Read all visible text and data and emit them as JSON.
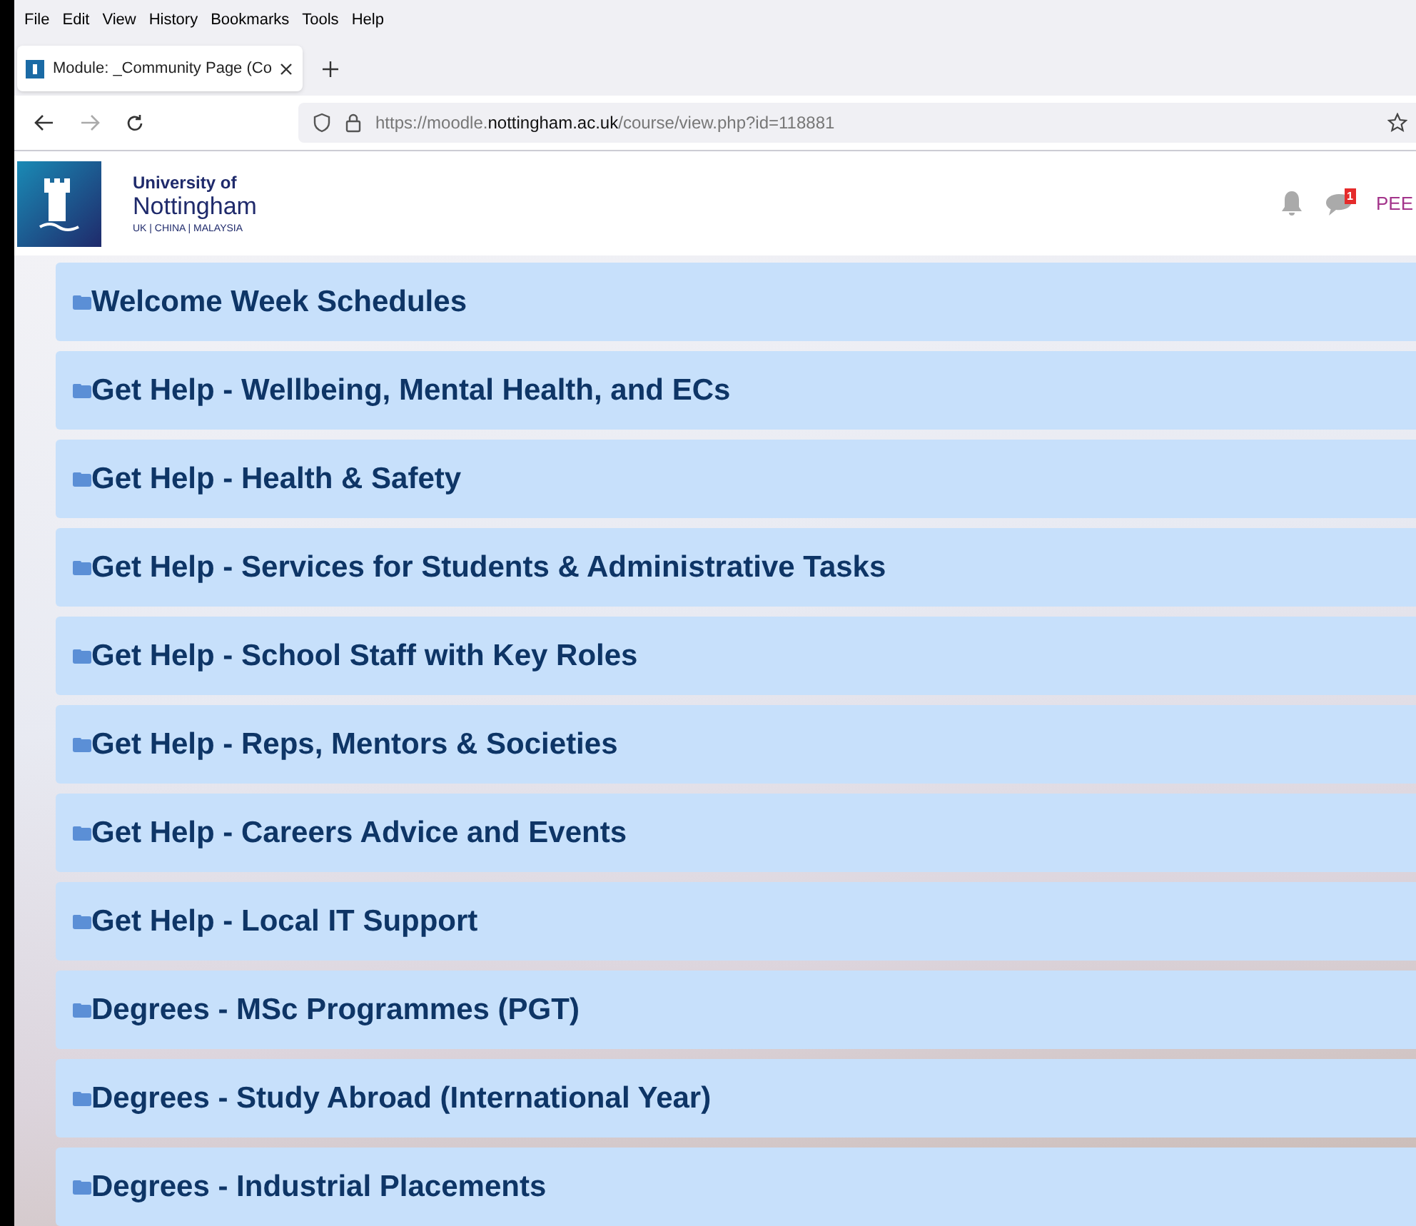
{
  "menu_bar": [
    "File",
    "Edit",
    "View",
    "History",
    "Bookmarks",
    "Tools",
    "Help"
  ],
  "tabs": [
    {
      "title": "Module: _Community Page (Co",
      "selected": true
    }
  ],
  "address_bar": {
    "scheme": "https://moodle.",
    "domain": "nottingham.ac.uk",
    "path": "/course/view.php?id=118881"
  },
  "site_header": {
    "logo_line_1": "University of",
    "logo_line_2": "Nottingham",
    "logo_line_3": "UK | CHINA | MALAYSIA",
    "message_count": "1",
    "user": "PEE"
  },
  "sections": [
    {
      "title": "Welcome Week Schedules"
    },
    {
      "title": "Get Help - Wellbeing, Mental Health, and ECs"
    },
    {
      "title": "Get Help - Health & Safety"
    },
    {
      "title": "Get Help - Services for Students & Administrative Tasks"
    },
    {
      "title": "Get Help - School Staff with Key Roles"
    },
    {
      "title": "Get Help - Reps, Mentors & Societies"
    },
    {
      "title": "Get Help - Careers Advice and Events"
    },
    {
      "title": "Get Help - Local IT Support"
    },
    {
      "title": "Degrees - MSc Programmes (PGT)"
    },
    {
      "title": "Degrees - Study Abroad (International Year)"
    },
    {
      "title": "Degrees - Industrial Placements"
    }
  ]
}
